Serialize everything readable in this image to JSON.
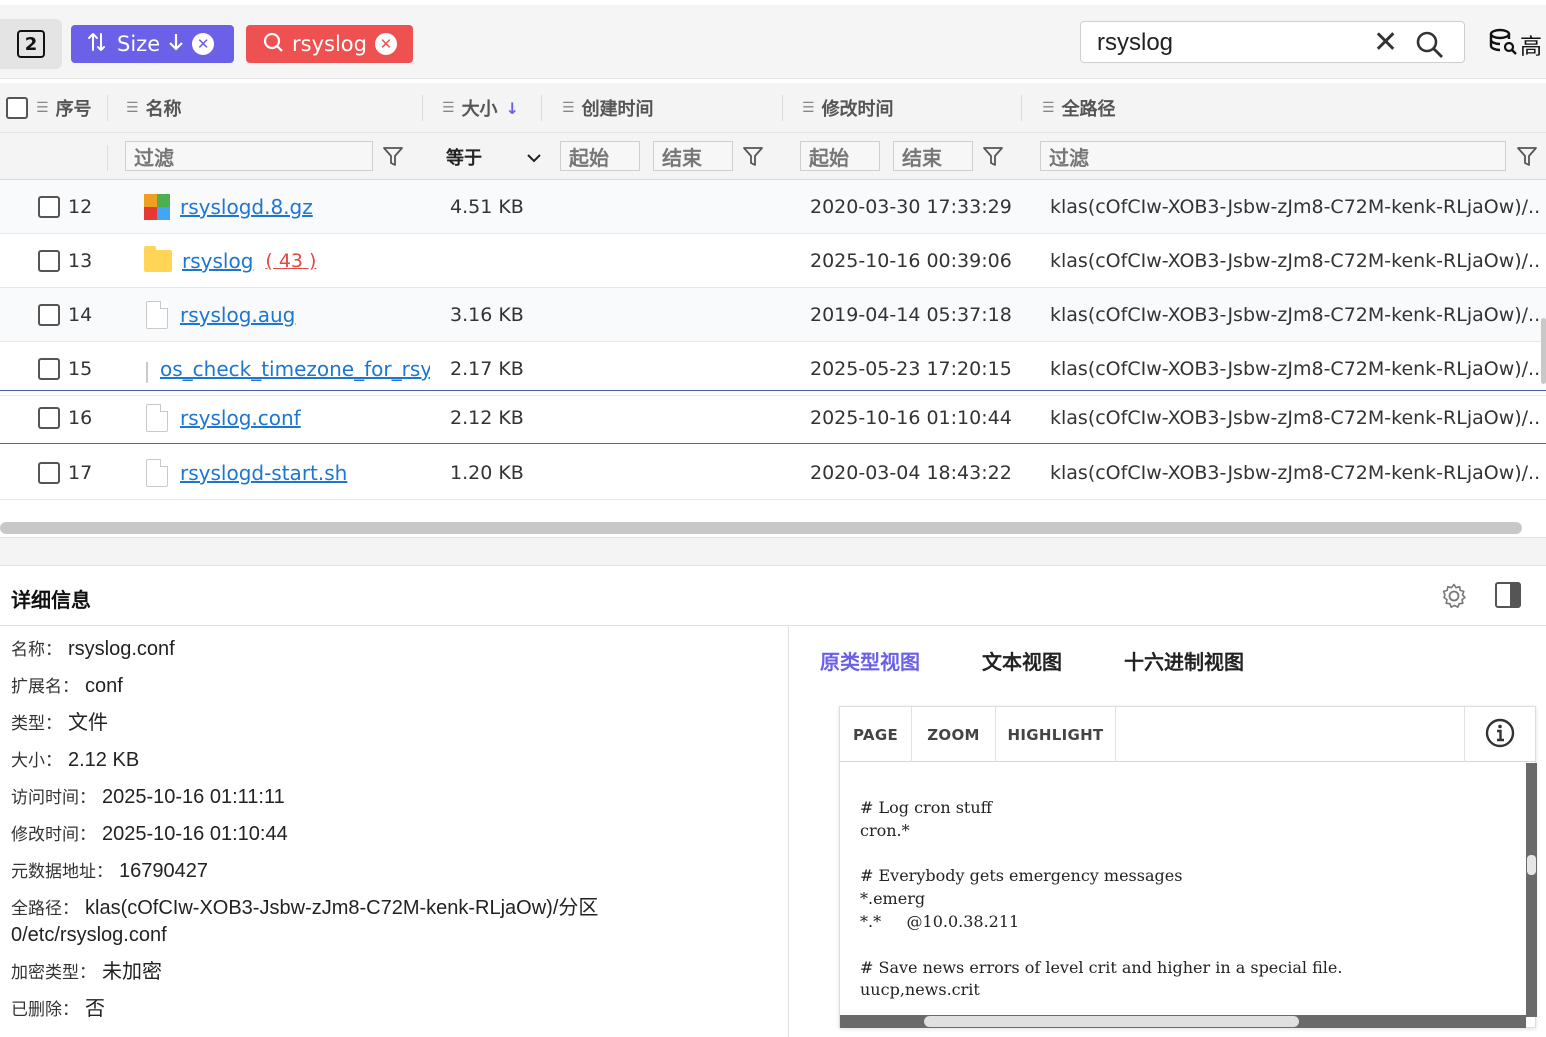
{
  "toolbar": {
    "pane_number": "2",
    "size_chip_label": "Size",
    "query_chip_label": "rsyslog",
    "search_value": "rsyslog",
    "advanced_label": "高"
  },
  "columns": {
    "index": "序号",
    "name": "名称",
    "size": "大小",
    "created": "创建时间",
    "modified": "修改时间",
    "path": "全路径"
  },
  "filters": {
    "name_placeholder": "过滤",
    "size_op": "等于",
    "created_start": "起始",
    "created_end": "结束",
    "modified_start": "起始",
    "modified_end": "结束",
    "path_placeholder": "过滤"
  },
  "rows": [
    {
      "index": "12",
      "name": "rsyslogd.8.gz",
      "icon": "zip-icon",
      "count": "",
      "size": "4.51 KB",
      "created": "",
      "modified": "2020-03-30 17:33:29",
      "path": "klas(cOfCIw-XOB3-Jsbw-zJm8-C72M-kenk-RLjaOw)/..."
    },
    {
      "index": "13",
      "name": "rsyslog",
      "icon": "folder-icon",
      "count": "( 43 )",
      "size": "",
      "created": "",
      "modified": "2025-10-16 00:39:06",
      "path": "klas(cOfCIw-XOB3-Jsbw-zJm8-C72M-kenk-RLjaOw)/..."
    },
    {
      "index": "14",
      "name": "rsyslog.aug",
      "icon": "file-icon",
      "count": "",
      "size": "3.16 KB",
      "created": "",
      "modified": "2019-04-14 05:37:18",
      "path": "klas(cOfCIw-XOB3-Jsbw-zJm8-C72M-kenk-RLjaOw)/..."
    },
    {
      "index": "15",
      "name": "os_check_timezone_for_rsys",
      "icon": "file-icon",
      "count": "",
      "size": "2.17 KB",
      "created": "",
      "modified": "2025-05-23 17:20:15",
      "path": "klas(cOfCIw-XOB3-Jsbw-zJm8-C72M-kenk-RLjaOw)/..."
    },
    {
      "index": "16",
      "name": "rsyslog.conf",
      "icon": "file-icon",
      "count": "",
      "size": "2.12 KB",
      "created": "",
      "modified": "2025-10-16 01:10:44",
      "path": "klas(cOfCIw-XOB3-Jsbw-zJm8-C72M-kenk-RLjaOw)/..."
    },
    {
      "index": "17",
      "name": "rsyslogd-start.sh",
      "icon": "file-icon",
      "count": "",
      "size": "1.20 KB",
      "created": "",
      "modified": "2020-03-04 18:43:22",
      "path": "klas(cOfCIw-XOB3-Jsbw-zJm8-C72M-kenk-RLjaOw)/..."
    }
  ],
  "detail": {
    "title": "详细信息",
    "props": [
      {
        "key": "名称：",
        "value": "rsyslog.conf"
      },
      {
        "key": "扩展名：",
        "value": "conf"
      },
      {
        "key": "类型：",
        "value": "文件"
      },
      {
        "key": "大小：",
        "value": "2.12 KB"
      },
      {
        "key": "访问时间：",
        "value": "2025-10-16 01:11:11"
      },
      {
        "key": "修改时间：",
        "value": "2025-10-16 01:10:44"
      },
      {
        "key": "元数据地址：",
        "value": "16790427"
      },
      {
        "key": "全路径：",
        "value": "klas(cOfCIw-XOB3-Jsbw-zJm8-C72M-kenk-RLjaOw)/分区 0/etc/rsyslog.conf"
      },
      {
        "key": "加密类型：",
        "value": "未加密"
      },
      {
        "key": "已删除：",
        "value": "否"
      }
    ]
  },
  "viewer": {
    "tabs": [
      "原类型视图",
      "文本视图",
      "十六进制视图"
    ],
    "active_tab": "原类型视图",
    "toolbar": [
      "PAGE",
      "ZOOM",
      "HIGHLIGHT"
    ],
    "content": "# Log cron stuff\ncron.*\n\n# Everybody gets emergency messages\n*.emerg\n*.*     @10.0.38.211\n\n# Save news errors of level crit and higher in a special file.\nuucp,news.crit"
  },
  "colors": {
    "accent": "#6b61e8",
    "danger": "#ef5050",
    "link": "#1c76d2"
  }
}
